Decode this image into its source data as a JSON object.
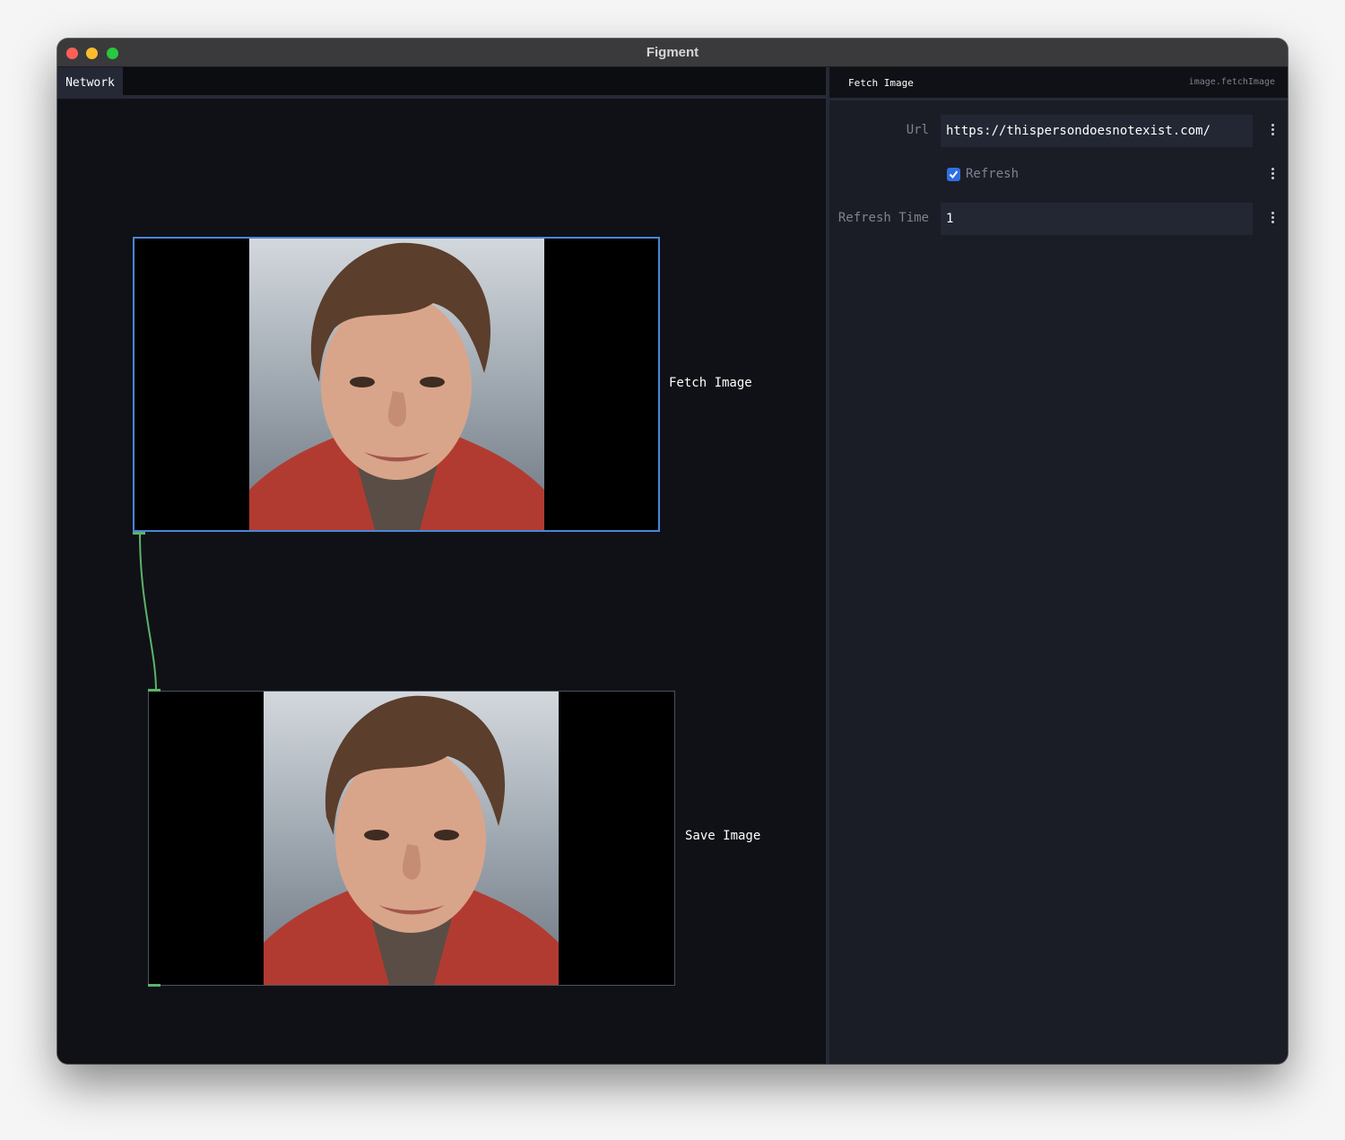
{
  "window": {
    "title": "Figment"
  },
  "network": {
    "tab_label": "Network",
    "nodes": [
      {
        "label": "Fetch Image",
        "selected": true
      },
      {
        "label": "Save Image",
        "selected": false
      }
    ],
    "connection_color": "#5bb36a"
  },
  "params": {
    "title": "Fetch Image",
    "operator": "image.fetchImage",
    "url_label": "Url",
    "url_value": "https://thispersondoesnotexist.com/",
    "refresh_label": "Refresh",
    "refresh_checked": true,
    "refresh_time_label": "Refresh Time",
    "refresh_time_value": "1"
  },
  "colors": {
    "accent": "#4a86d8",
    "checkbox": "#2f6fe4"
  }
}
